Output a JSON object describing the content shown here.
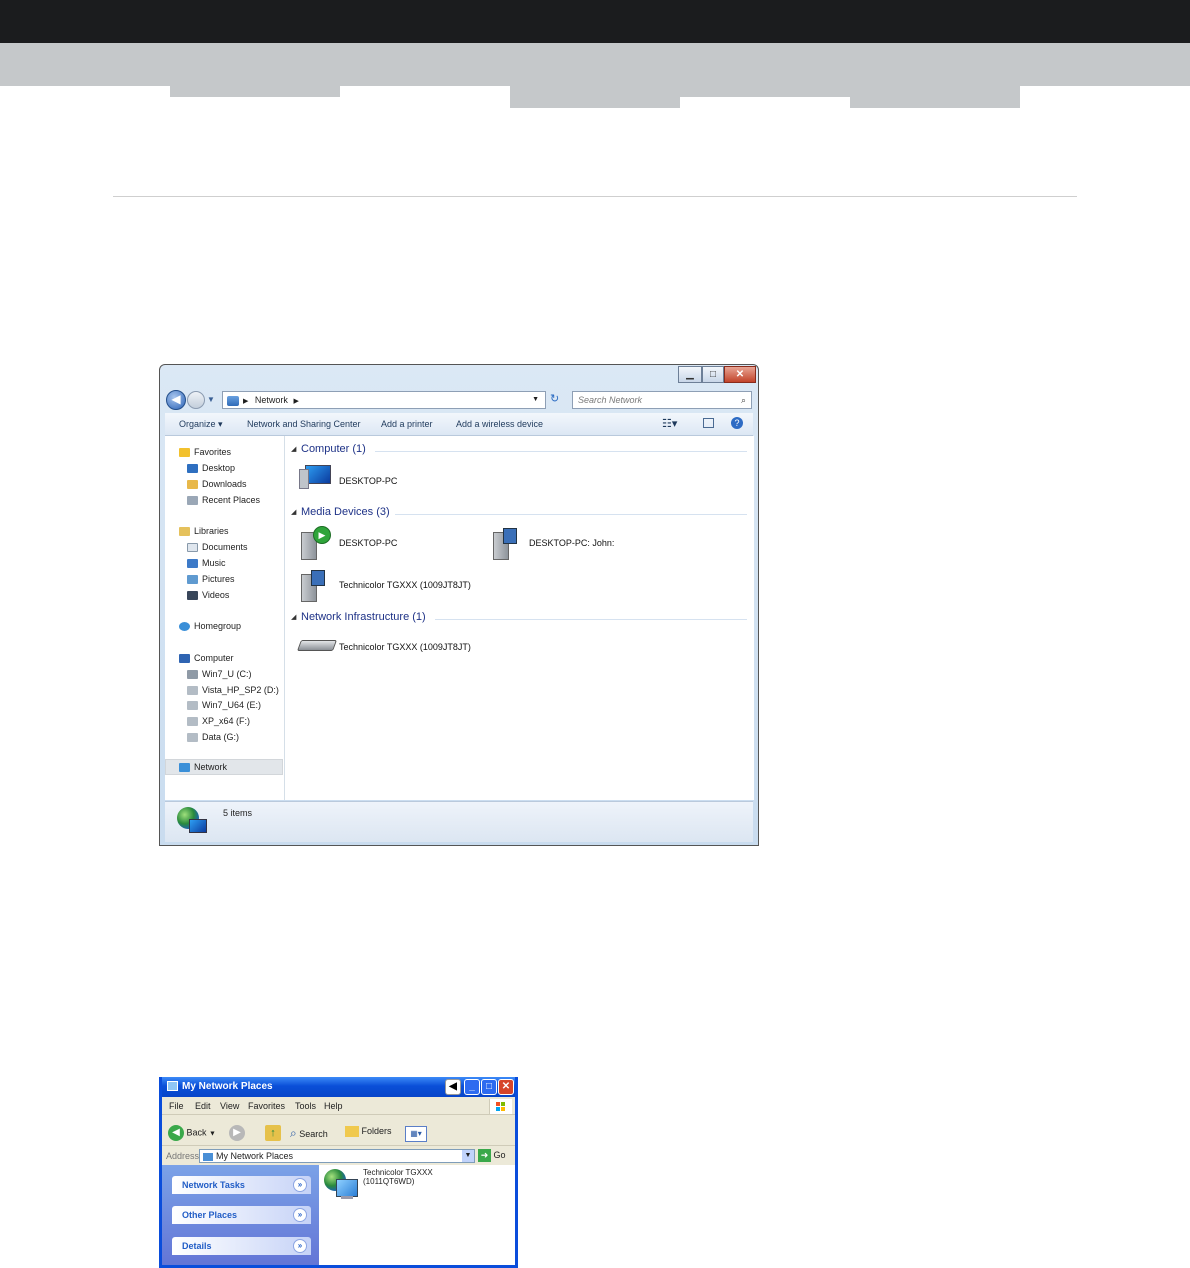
{
  "win7": {
    "breadcrumb": "Network",
    "search_placeholder": "Search Network",
    "commands": [
      "Organize ▾",
      "Network and Sharing Center",
      "Add a printer",
      "Add a wireless device"
    ],
    "nav": {
      "favorites": "Favorites",
      "desktop": "Desktop",
      "downloads": "Downloads",
      "recent": "Recent Places",
      "libraries": "Libraries",
      "documents": "Documents",
      "music": "Music",
      "pictures": "Pictures",
      "videos": "Videos",
      "homegroup": "Homegroup",
      "computer": "Computer",
      "drive_c": "Win7_U (C:)",
      "drive_d": "Vista_HP_SP2 (D:)",
      "drive_e": "Win7_U64 (E:)",
      "drive_f": "XP_x64 (F:)",
      "drive_g": "Data (G:)",
      "network": "Network"
    },
    "groups": {
      "computer": "Computer (1)",
      "media": "Media Devices (3)",
      "infra": "Network Infrastructure (1)"
    },
    "items": {
      "computer_pc": "DESKTOP-PC",
      "media_pc": "DESKTOP-PC",
      "media_john": "DESKTOP-PC: John:",
      "media_tg": "Technicolor TGXXX (1009JT8JT)",
      "infra_tg": "Technicolor TGXXX (1009JT8JT)"
    },
    "status": "5 items"
  },
  "xp": {
    "title": "My Network Places",
    "menu": [
      "File",
      "Edit",
      "View",
      "Favorites",
      "Tools",
      "Help"
    ],
    "toolbar": {
      "back": "Back",
      "search": "Search",
      "folders": "Folders"
    },
    "address_label": "Address",
    "address_value": "My Network Places",
    "go": "Go",
    "panels": [
      "Network Tasks",
      "Other Places",
      "Details"
    ],
    "item_line1": "Technicolor TGXXX",
    "item_line2": "(1011QT6WD)"
  }
}
